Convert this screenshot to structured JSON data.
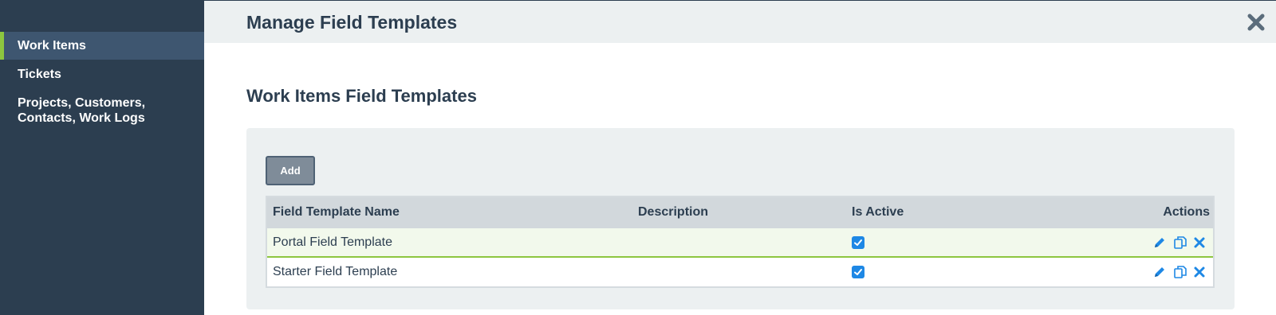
{
  "sidebar": {
    "items": [
      {
        "label": "Work Items",
        "active": true
      },
      {
        "label": "Tickets",
        "active": false
      },
      {
        "label": "Projects, Customers, Contacts, Work Logs",
        "active": false
      }
    ]
  },
  "header": {
    "title": "Manage Field Templates",
    "close_icon": "close-icon"
  },
  "main": {
    "section_title": "Work Items Field Templates",
    "add_label": "Add",
    "table": {
      "columns": [
        "Field Template Name",
        "Description",
        "Is Active",
        "Actions"
      ],
      "rows": [
        {
          "name": "Portal Field Template",
          "description": "",
          "is_active": true
        },
        {
          "name": "Starter Field Template",
          "description": "",
          "is_active": true
        }
      ],
      "action_icons": [
        "edit-icon",
        "copy-icon",
        "delete-icon"
      ]
    }
  },
  "colors": {
    "sidebar_bg": "#2c3e50",
    "accent_green": "#8dc63f",
    "header_bg": "#ecf0f1",
    "link_blue": "#1e88e5",
    "button_bg": "#7f8c99"
  }
}
